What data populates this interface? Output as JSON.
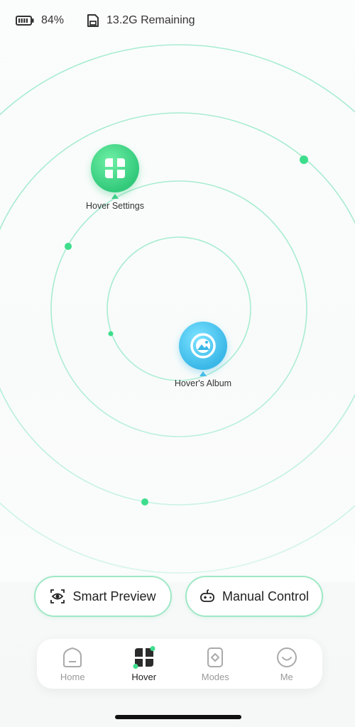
{
  "status": {
    "battery_percent": "84%",
    "storage": "13.2G Remaining"
  },
  "nodes": {
    "settings_label": "Hover Settings",
    "album_label": "Hover's Album"
  },
  "actions": {
    "smart_preview": "Smart Preview",
    "manual_control": "Manual Control"
  },
  "tabs": [
    {
      "label": "Home",
      "icon": "home-icon",
      "active": false
    },
    {
      "label": "Hover",
      "icon": "hover-icon",
      "active": true
    },
    {
      "label": "Modes",
      "icon": "modes-icon",
      "active": false
    },
    {
      "label": "Me",
      "icon": "me-icon",
      "active": false
    }
  ],
  "colors": {
    "ring": "#9fe8c6",
    "accent_green": "#3ccf86",
    "accent_blue": "#45bde9"
  }
}
